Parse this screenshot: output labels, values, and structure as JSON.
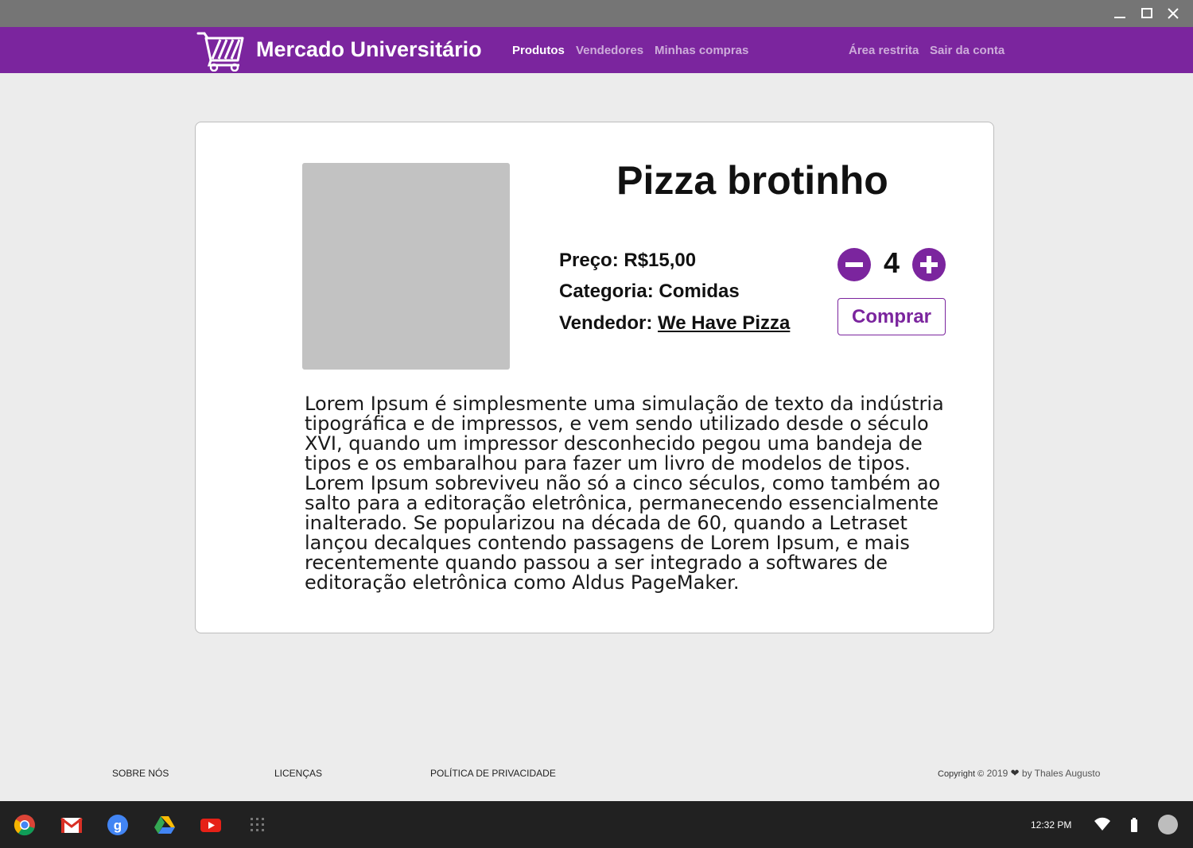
{
  "app": {
    "title": "Mercado Universitário"
  },
  "nav": {
    "left": [
      "Produtos",
      "Vendedores",
      "Minhas compras"
    ],
    "right": [
      "Área restrita",
      "Sair da conta"
    ]
  },
  "product": {
    "name": "Pizza brotinho",
    "price_label": "Preço:",
    "price_value": "R$15,00",
    "category_label": "Categoria:",
    "category_value": "Comidas",
    "seller_label": "Vendedor:",
    "seller_value": "We Have Pizza",
    "quantity": "4",
    "buy_label": "Comprar",
    "description": "Lorem Ipsum é simplesmente uma simulação de texto da indústria tipográfica e de impressos, e vem sendo utilizado desde o século XVI, quando um impressor desconhecido pegou uma bandeja de tipos e os embaralhou para fazer um livro de modelos de tipos. Lorem Ipsum sobreviveu não só a cinco séculos, como também ao salto para a editoração eletrônica, permanecendo essencialmente inalterado. Se popularizou na década de 60, quando a Letraset lançou decalques contendo passagens de Lorem Ipsum, e mais recentemente quando passou a ser integrado a softwares de editoração eletrônica como Aldus PageMaker."
  },
  "footer": {
    "links": [
      "SOBRE NÓS",
      "LICENÇAS",
      "POLÍTICA DE PRIVACIDADE"
    ],
    "copyright_prefix": "Copyright ©",
    "copyright_year": "2019",
    "copyright_by": "by Thales Augusto"
  },
  "taskbar": {
    "apps": [
      "chrome-icon",
      "gmail-icon",
      "google-search-icon",
      "drive-icon",
      "youtube-icon",
      "launcher-icon"
    ],
    "time": "12:32 PM"
  },
  "colors": {
    "accent": "#7b259e",
    "background": "#ececec",
    "taskbar": "#212121",
    "titlebar": "#757575"
  }
}
